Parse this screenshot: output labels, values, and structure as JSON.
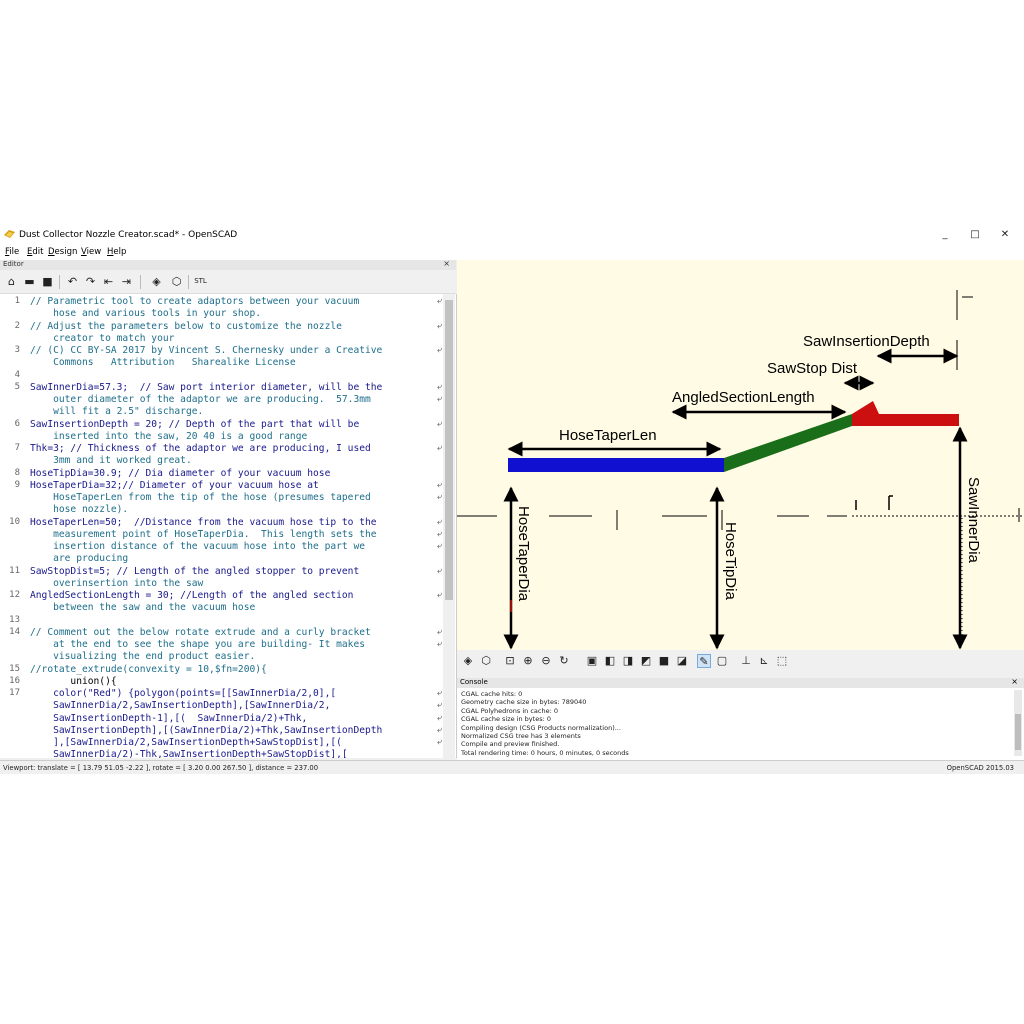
{
  "window": {
    "title": "Dust Collector Nozzle Creator.scad* - OpenSCAD",
    "minimize": "_",
    "maximize": "□",
    "close": "✕"
  },
  "menu": [
    "File",
    "Edit",
    "Design",
    "View",
    "Help"
  ],
  "editor": {
    "header": "Editor",
    "close": "×",
    "lines": [
      {
        "n": "1",
        "t": "// Parametric tool to create adaptors between your vacuum",
        "c": "comment"
      },
      {
        "n": "",
        "t": "    hose and various tools in your shop.",
        "c": "comment"
      },
      {
        "n": "2",
        "t": "// Adjust the parameters below to customize the nozzle",
        "c": "comment"
      },
      {
        "n": "",
        "t": "    creator to match your",
        "c": "comment"
      },
      {
        "n": "3",
        "t": "// (C) CC BY-SA 2017 by Vincent S. Chernesky under a Creative",
        "c": "comment"
      },
      {
        "n": "",
        "t": "    Commons   Attribution   Sharealike License",
        "c": "comment"
      },
      {
        "n": "4",
        "t": "",
        "c": "comment"
      },
      {
        "n": "5",
        "t": "SawInnerDia=57.3;  // Saw port interior diameter, will be the",
        "c": "mix"
      },
      {
        "n": "",
        "t": "    outer diameter of the adaptor we are producing.  57.3mm",
        "c": "comment"
      },
      {
        "n": "",
        "t": "    will fit a 2.5\" discharge.",
        "c": "comment"
      },
      {
        "n": "6",
        "t": "SawInsertionDepth = 20; // Depth of the part that will be",
        "c": "mix"
      },
      {
        "n": "",
        "t": "    inserted into the saw, 20 40 is a good range",
        "c": "comment"
      },
      {
        "n": "7",
        "t": "Thk=3; // Thickness of the adaptor we are producing, I used",
        "c": "mix"
      },
      {
        "n": "",
        "t": "    3mm and it worked great.",
        "c": "comment"
      },
      {
        "n": "8",
        "t": "HoseTipDia=30.9; // Dia diameter of your vacuum hose",
        "c": "mix"
      },
      {
        "n": "9",
        "t": "HoseTaperDia=32;// Diameter of your vacuum hose at",
        "c": "mix"
      },
      {
        "n": "",
        "t": "    HoseTaperLen from the tip of the hose (presumes tapered",
        "c": "comment"
      },
      {
        "n": "",
        "t": "    hose nozzle).",
        "c": "comment"
      },
      {
        "n": "10",
        "t": "HoseTaperLen=50;  //Distance from the vacuum hose tip to the",
        "c": "mix"
      },
      {
        "n": "",
        "t": "    measurement point of HoseTaperDia.  This length sets the",
        "c": "comment"
      },
      {
        "n": "",
        "t": "    insertion distance of the vacuum hose into the part we",
        "c": "comment"
      },
      {
        "n": "",
        "t": "    are producing",
        "c": "comment"
      },
      {
        "n": "11",
        "t": "SawStopDist=5; // Length of the angled stopper to prevent",
        "c": "mix"
      },
      {
        "n": "",
        "t": "    overinsertion into the saw",
        "c": "comment"
      },
      {
        "n": "12",
        "t": "AngledSectionLength = 30; //Length of the angled section",
        "c": "mix"
      },
      {
        "n": "",
        "t": "    between the saw and the vacuum hose",
        "c": "comment"
      },
      {
        "n": "13",
        "t": "",
        "c": "comment"
      },
      {
        "n": "14",
        "t": "// Comment out the below rotate extrude and a curly bracket",
        "c": "comment"
      },
      {
        "n": "",
        "t": "    at the end to see the shape you are building- It makes",
        "c": "comment"
      },
      {
        "n": "",
        "t": "    visualizing the end product easier.",
        "c": "comment"
      },
      {
        "n": "15",
        "t": "//rotate_extrude(convexity = 10,$fn=200){",
        "c": "comment"
      },
      {
        "n": "16",
        "t": "       union(){",
        "c": "key"
      },
      {
        "n": "17",
        "t": "    color(\"Red\") {polygon(points=[[SawInnerDia/2,0],[",
        "c": "mix"
      },
      {
        "n": "",
        "t": "    SawInnerDia/2,SawInsertionDepth],[SawInnerDia/2,",
        "c": "mix"
      },
      {
        "n": "",
        "t": "    SawInsertionDepth-1],[(  SawInnerDia/2)+Thk,",
        "c": "mix"
      },
      {
        "n": "",
        "t": "    SawInsertionDepth],[(SawInnerDia/2)+Thk,SawInsertionDepth",
        "c": "mix"
      },
      {
        "n": "",
        "t": "    ],[SawInnerDia/2,SawInsertionDepth+SawStopDist],[(",
        "c": "mix"
      },
      {
        "n": "",
        "t": "    SawInnerDia/2)-Thk,SawInsertionDepth+SawStopDist],[",
        "c": "mix"
      }
    ]
  },
  "viewport": {
    "labels": {
      "saw_insertion_depth": "SawInsertionDepth",
      "saw_stop_dist": "SawStop Dist",
      "angled_section_length": "AngledSectionLength",
      "hose_taper_len": "HoseTaperLen",
      "hose_taper_dia": "HoseTaperDia",
      "hose_tip_dia": "HoseTipDia",
      "saw_inner_dia": "SawInnerDia"
    },
    "colors": {
      "hose_section": "#1010d0",
      "angled_section": "#1a6e1a",
      "saw_section": "#cc1010",
      "background": "#fffbe5"
    }
  },
  "console": {
    "header": "Console",
    "close": "×",
    "lines": [
      "CGAL cache hits: 0",
      "Geometry cache size in bytes: 789040",
      "CGAL Polyhedrons in cache: 0",
      "CGAL cache size in bytes: 0",
      "Compiling design (CSG Products normalization)...",
      "Normalized CSG tree has 3 elements",
      "Compile and preview finished.",
      "Total rendering time: 0 hours, 0 minutes, 0 seconds"
    ]
  },
  "status": {
    "left": "Viewport: translate = [ 13.79 51.05 -2.22 ], rotate = [ 3.20 0.00 267.50 ], distance = 237.00",
    "right": "OpenSCAD 2015.03"
  }
}
